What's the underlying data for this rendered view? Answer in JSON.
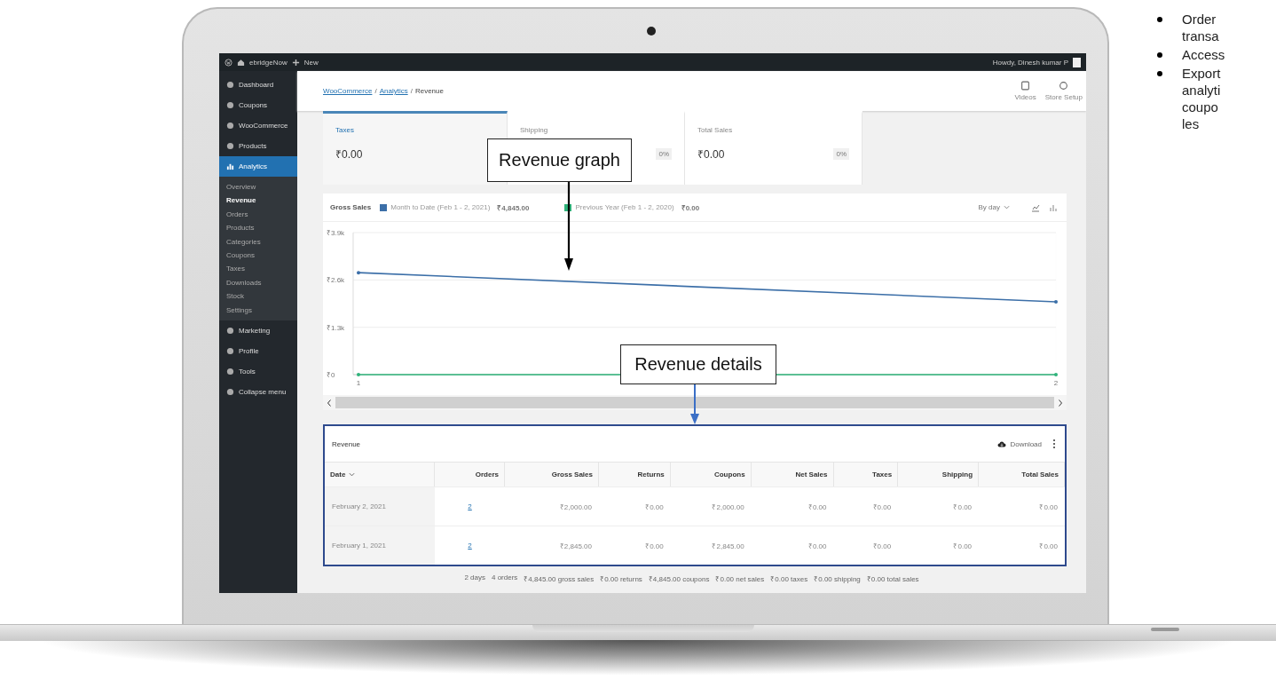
{
  "admin_bar": {
    "site": "ebridgeNow",
    "new": "New",
    "greeting": "Howdy, Dinesh kumar P"
  },
  "sidebar": {
    "items": [
      {
        "label": "Dashboard",
        "selected": false
      },
      {
        "label": "Coupons",
        "selected": false
      },
      {
        "label": "WooCommerce",
        "selected": false
      },
      {
        "label": "Products",
        "selected": false
      },
      {
        "label": "Analytics",
        "selected": true,
        "children": [
          {
            "label": "Overview",
            "selected": false
          },
          {
            "label": "Revenue",
            "selected": true
          },
          {
            "label": "Orders",
            "selected": false
          },
          {
            "label": "Products",
            "selected": false
          },
          {
            "label": "Categories",
            "selected": false
          },
          {
            "label": "Coupons",
            "selected": false
          },
          {
            "label": "Taxes",
            "selected": false
          },
          {
            "label": "Downloads",
            "selected": false
          },
          {
            "label": "Stock",
            "selected": false
          },
          {
            "label": "Settings",
            "selected": false
          }
        ]
      },
      {
        "label": "Marketing",
        "selected": false
      },
      {
        "label": "Profile",
        "selected": false
      },
      {
        "label": "Tools",
        "selected": false
      },
      {
        "label": "Collapse menu",
        "selected": false
      }
    ]
  },
  "breadcrumb": [
    {
      "label": "WooCommerce",
      "link": true
    },
    {
      "label": "Analytics",
      "link": true,
      "separator": "/"
    },
    {
      "label": "Revenue",
      "link": false,
      "separator": "/"
    }
  ],
  "header_actions": [
    "Videos",
    "Store Setup"
  ],
  "stats": [
    {
      "label": "Taxes",
      "value": "₹0.00",
      "selected": true
    },
    {
      "label": "Shipping",
      "delta": "0%",
      "selected": false
    },
    {
      "label": "Total Sales",
      "value": "₹0.00",
      "delta": "0%",
      "selected": false
    }
  ],
  "chart_panel": {
    "title": "Gross Sales",
    "legend": [
      {
        "value": "₹4,845.00",
        "checked": true
      },
      {
        "value": "₹0.00",
        "checked": true
      }
    ],
    "interval": "By day",
    "chart_data": {
      "type": "line",
      "categories": [
        "1",
        "2"
      ],
      "ylim": [
        0,
        3900
      ],
      "yticks": [
        {
          "value": 0,
          "label": "₹0"
        },
        {
          "value": 1300,
          "label": "₹1.3k"
        },
        {
          "value": 2600,
          "label": "₹2.6k"
        },
        {
          "value": 3900,
          "label": "₹3.9k"
        }
      ],
      "series": [
        {
          "name": "Month to Date (Feb 1 - 2, 2021)",
          "color": "#3c6fa8",
          "values": [
            2800,
            2000
          ]
        },
        {
          "name": "Previous Year (Feb 1 - 2, 2020)",
          "color": "#2fb37a",
          "values": [
            0,
            0
          ]
        }
      ]
    }
  },
  "table": {
    "title": "Revenue",
    "download": "Download",
    "columns": [
      "Date",
      "Orders",
      "Gross Sales",
      "Returns",
      "Coupons",
      "Net Sales",
      "Taxes",
      "Shipping",
      "Total Sales"
    ],
    "rows": [
      [
        "February 2, 2021",
        "2",
        "₹2,000.00",
        "₹0.00",
        "₹2,000.00",
        "₹0.00",
        "₹0.00",
        "₹0.00",
        "₹0.00"
      ],
      [
        "February 1, 2021",
        "2",
        "₹2,845.00",
        "₹0.00",
        "₹2,845.00",
        "₹0.00",
        "₹0.00",
        "₹0.00",
        "₹0.00"
      ]
    ],
    "summary": [
      "2 days",
      "4 orders",
      "₹4,845.00 gross sales",
      "₹0.00 returns",
      "₹4,845.00 coupons",
      "₹0.00 net sales",
      "₹0.00 taxes",
      "₹0.00 shipping",
      "₹0.00 total sales"
    ]
  },
  "callouts": [
    "Revenue graph",
    "Revenue details"
  ],
  "bullets": [
    {
      "lines": [
        "Order",
        "transa"
      ]
    },
    {
      "lines": [
        "Access"
      ]
    },
    {
      "lines": [
        "Export",
        "analyti",
        "coupo",
        "les"
      ]
    }
  ]
}
